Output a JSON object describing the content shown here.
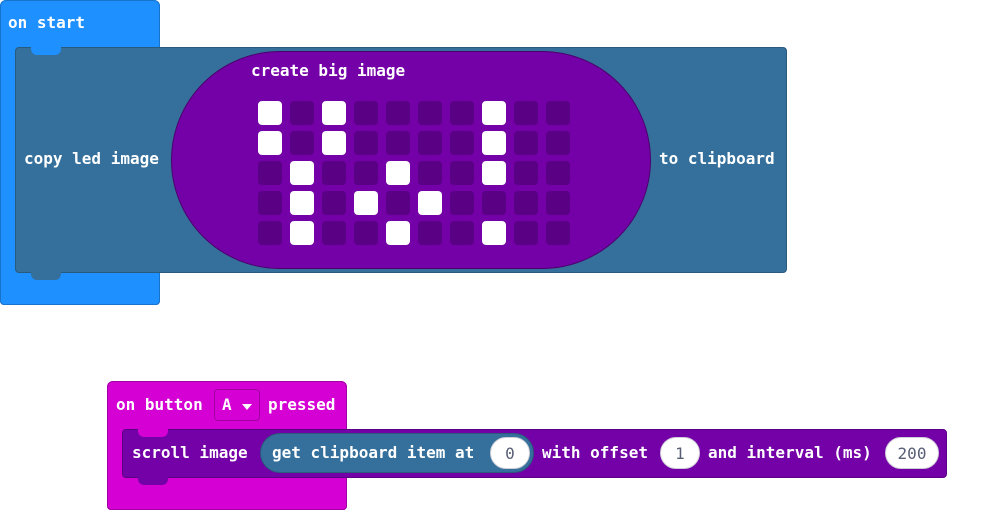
{
  "on_start": {
    "label": "on start",
    "copy_label": "copy led image",
    "create_label": "create big image",
    "to_label": "to clipboard",
    "led_grid": [
      [
        1,
        0,
        1,
        0,
        0,
        0,
        0,
        1,
        0,
        0
      ],
      [
        1,
        0,
        1,
        0,
        0,
        0,
        0,
        1,
        0,
        0
      ],
      [
        0,
        1,
        0,
        0,
        1,
        0,
        0,
        1,
        0,
        0
      ],
      [
        0,
        1,
        0,
        1,
        0,
        1,
        0,
        0,
        0,
        0
      ],
      [
        0,
        1,
        0,
        0,
        1,
        0,
        0,
        1,
        0,
        0
      ]
    ]
  },
  "on_button": {
    "label_pre": "on button",
    "button_value": "A",
    "label_post": "pressed",
    "scroll_label": "scroll image",
    "clipboard_label": "get clipboard item at",
    "clipboard_index": "0",
    "offset_label": "with offset",
    "offset_value": "1",
    "interval_label": "and interval (ms)",
    "interval_value": "200"
  },
  "colors": {
    "basic": "#1e90ff",
    "images": "#34709b",
    "led": "#7400a8",
    "input": "#d400d4"
  }
}
